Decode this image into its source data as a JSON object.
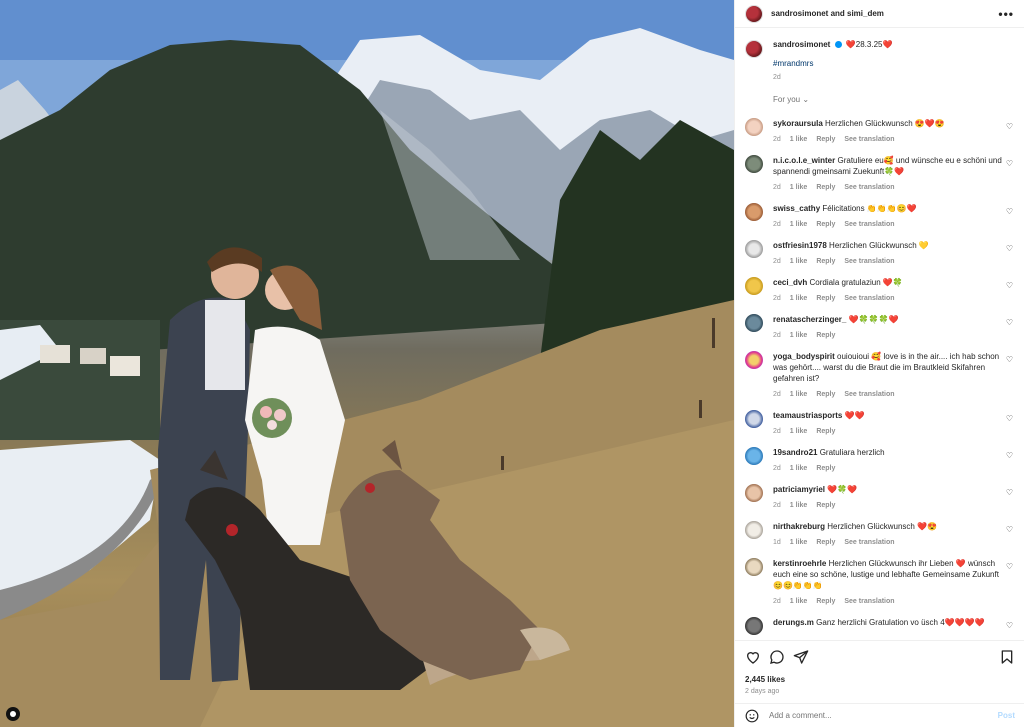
{
  "post": {
    "header_name": "sandrosimonet and simi_dem",
    "more_icon": "more-dots-icon",
    "caption_user": "sandrosimonet",
    "caption_text": "❤️28.3.25❤️",
    "hashtag": "#mrandmrs",
    "caption_age": "2d",
    "for_you": "For you"
  },
  "comments": [
    {
      "user": "sykoraursula",
      "text": "Herzlichen Glückwunsch 😍❤️😍",
      "age": "2d",
      "likes": "1 like",
      "reply": "Reply",
      "translate": "See translation"
    },
    {
      "user": "n.i.c.o.l.e_winter",
      "text": "Gratuliere eu🥰 und wünsche eu e schöni und spannendi gmeinsami Zuekunft🍀❤️",
      "age": "2d",
      "likes": "1 like",
      "reply": "Reply",
      "translate": "See translation"
    },
    {
      "user": "swiss_cathy",
      "text": "Félicitations 👏👏👏😊❤️",
      "age": "2d",
      "likes": "1 like",
      "reply": "Reply",
      "translate": "See translation"
    },
    {
      "user": "ostfriesin1978",
      "text": "Herzlichen Glückwunsch 💛",
      "age": "2d",
      "likes": "1 like",
      "reply": "Reply",
      "translate": "See translation"
    },
    {
      "user": "ceci_dvh",
      "text": "Cordiala gratulaziun ❤️🍀",
      "age": "2d",
      "likes": "1 like",
      "reply": "Reply",
      "translate": "See translation"
    },
    {
      "user": "renatascherzinger_",
      "text": "❤️🍀🍀🍀❤️",
      "age": "2d",
      "likes": "1 like",
      "reply": "Reply",
      "translate": ""
    },
    {
      "user": "yoga_bodyspirit",
      "text": "ouiouioui 🥰 love is in the air.... ich hab schon was gehört.... warst du die Braut die im Brautkleid Skifahren gefahren ist?",
      "age": "2d",
      "likes": "1 like",
      "reply": "Reply",
      "translate": "See translation"
    },
    {
      "user": "teamaustriasports",
      "text": "❤️❤️",
      "age": "2d",
      "likes": "1 like",
      "reply": "Reply",
      "translate": ""
    },
    {
      "user": "19sandro21",
      "text": "Gratuliara herzlich",
      "age": "2d",
      "likes": "1 like",
      "reply": "Reply",
      "translate": ""
    },
    {
      "user": "patriciamyriel",
      "text": "❤️🍀❤️",
      "age": "2d",
      "likes": "1 like",
      "reply": "Reply",
      "translate": ""
    },
    {
      "user": "nirthakreburg",
      "text": "Herzlichen Glückwunsch ❤️😍",
      "age": "1d",
      "likes": "1 like",
      "reply": "Reply",
      "translate": "See translation"
    },
    {
      "user": "kerstinroehrle",
      "text": "Herzlichen Glückwunsch ihr Lieben ❤️ wünsch euch eine so schöne, lustige und lebhafte Gemeinsame Zukunft 😊😊👏👏👏",
      "age": "2d",
      "likes": "1 like",
      "reply": "Reply",
      "translate": "See translation"
    },
    {
      "user": "derungs.m",
      "text": "Ganz herzlichi Gratulation vo üsch 4❤️❤️❤️❤️",
      "age": "",
      "likes": "",
      "reply": "",
      "translate": ""
    }
  ],
  "footer": {
    "likes": "2,445 likes",
    "ago": "2 days ago",
    "add_placeholder": "Add a comment...",
    "post_label": "Post"
  },
  "colors": {
    "link": "#00376b",
    "muted": "#8e8e8e",
    "post_disabled": "#b3dbff"
  }
}
